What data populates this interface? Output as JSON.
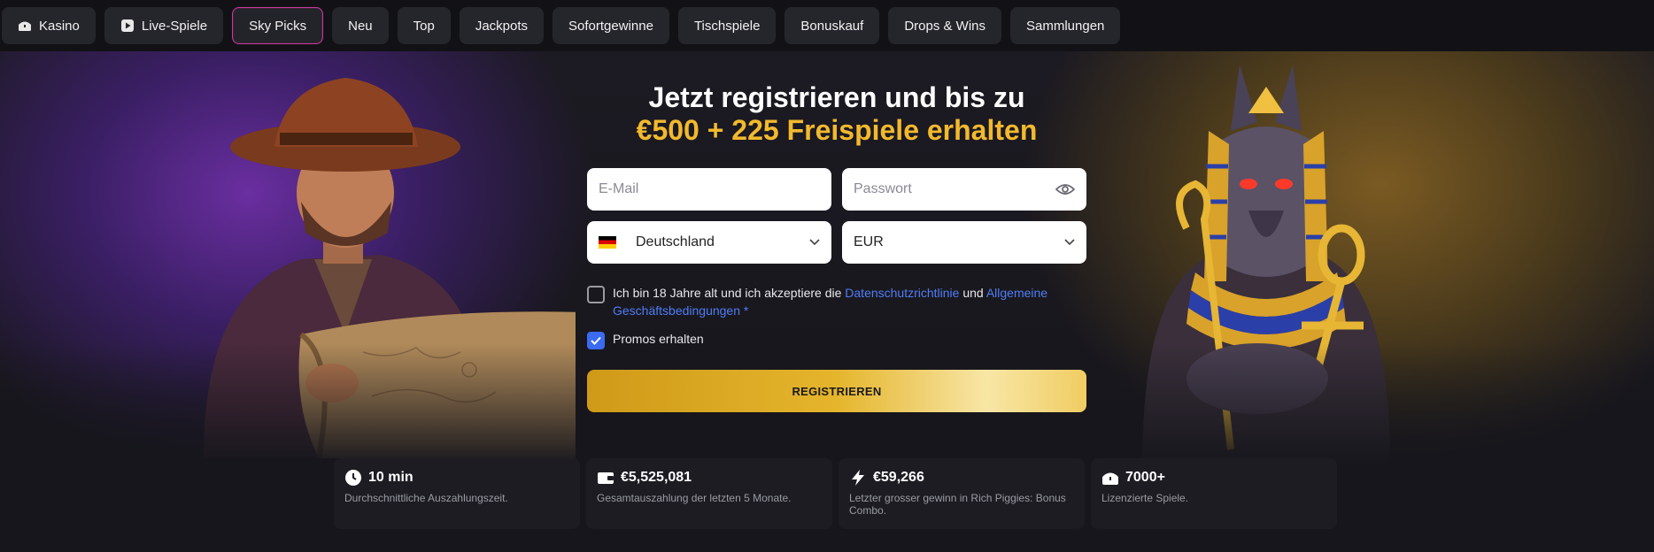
{
  "nav": {
    "tabs": [
      {
        "label": "Kasino",
        "icon": "chest-icon"
      },
      {
        "label": "Live-Spiele",
        "icon": "play-icon"
      },
      {
        "label": "Sky Picks"
      },
      {
        "label": "Neu"
      },
      {
        "label": "Top"
      },
      {
        "label": "Jackpots"
      },
      {
        "label": "Sofortgewinne"
      },
      {
        "label": "Tischspiele"
      },
      {
        "label": "Bonuskauf"
      },
      {
        "label": "Drops & Wins"
      },
      {
        "label": "Sammlungen"
      }
    ],
    "active_tab": "Sky Picks",
    "active_border_color": "#c9399c"
  },
  "hero": {
    "title_line1": "Jetzt registrieren und bis zu",
    "title_line2": "€500 + 225 Freispiele erhalten",
    "title_accent_color": "#f2b92e"
  },
  "form": {
    "email_placeholder": "E-Mail",
    "password_placeholder": "Passwort",
    "country_value": "Deutschland",
    "currency_value": "EUR",
    "terms_text_1": "Ich bin 18 Jahre alt und ich akzeptiere die ",
    "terms_link_privacy": "Datenschutzrichtlinie",
    "terms_text_2": " und ",
    "terms_link_general": "Allgemeine Geschäftsbedingungen",
    "terms_required": " *",
    "terms_checked": false,
    "promos_label": "Promos erhalten",
    "promos_checked": true,
    "register_label": "REGISTRIEREN",
    "link_color": "#4f7df5",
    "checkbox_color": "#3b6bf0"
  },
  "stats": [
    {
      "value": "10 min",
      "caption": "Durchschnittliche Auszahlungszeit.",
      "icon": "clock-icon"
    },
    {
      "value": "€5,525,081",
      "caption": "Gesamtauszahlung der letzten 5 Monate.",
      "icon": "wallet-icon"
    },
    {
      "value": "€59,266",
      "caption": "Letzter grosser gewinn in Rich Piggies: Bonus Combo.",
      "icon": "lightning-icon"
    },
    {
      "value": "7000+",
      "caption": "Lizenzierte Spiele.",
      "icon": "chest-icon"
    }
  ]
}
